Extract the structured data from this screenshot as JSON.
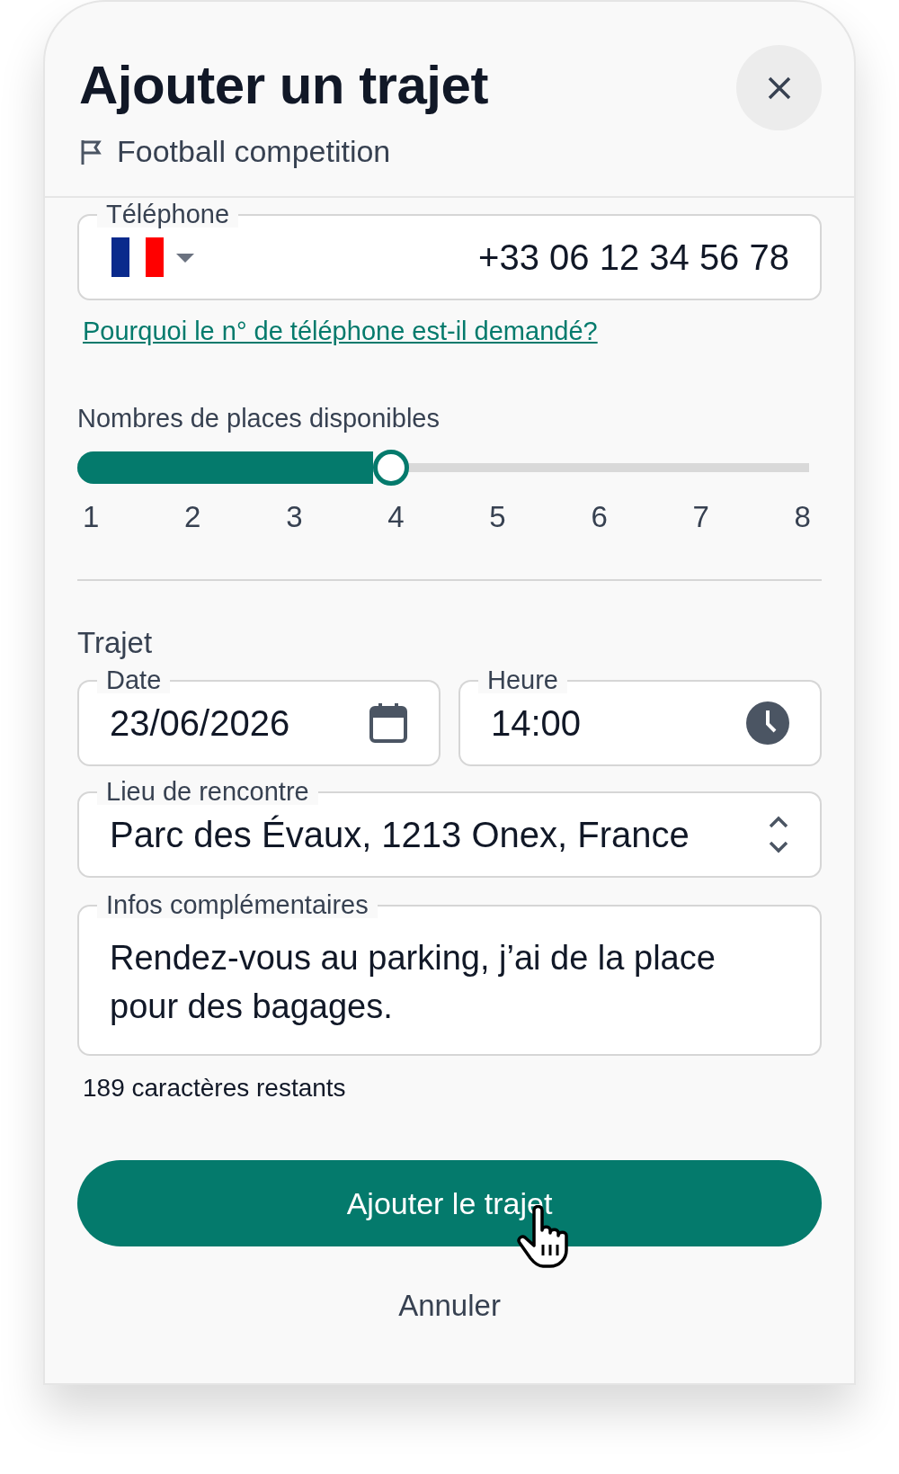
{
  "header": {
    "title": "Ajouter un trajet",
    "event": "Football competition"
  },
  "phone": {
    "label": "Téléphone",
    "value": "+33 06 12 34 56 78",
    "help_link": "Pourquoi le n° de téléphone est-il demandé?"
  },
  "seats": {
    "label": "Nombres de places disponibles",
    "level": 0.4286,
    "ticks": [
      "1",
      "2",
      "3",
      "4",
      "5",
      "6",
      "7",
      "8"
    ]
  },
  "trip": {
    "heading": "Trajet",
    "date": {
      "label": "Date",
      "value": "23/06/2026"
    },
    "time": {
      "label": "Heure",
      "value": "14:00"
    },
    "place": {
      "label": "Lieu de rencontre",
      "value": "Parc des Évaux, 1213 Onex, France"
    },
    "info": {
      "label": "Infos complémentaires",
      "value": "Rendez-vous au parking, j’ai de la place pour des bagages."
    },
    "counter": "189 caractères restants"
  },
  "actions": {
    "submit": "Ajouter le trajet",
    "cancel": "Annuler"
  }
}
